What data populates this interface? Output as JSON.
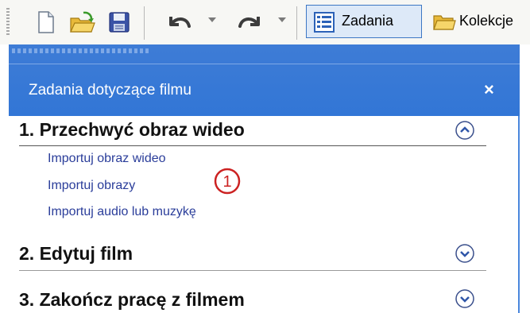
{
  "toolbar": {
    "tasks_button_label": "Zadania",
    "collections_button_label": "Kolekcje"
  },
  "panel": {
    "title": "Zadania dotyczące filmu",
    "close_glyph": "×",
    "sections": [
      {
        "title": "1. Przechwyć obraz wideo",
        "expanded": true,
        "links": [
          "Importuj obraz wideo",
          "Importuj obrazy",
          "Importuj audio lub muzykę"
        ]
      },
      {
        "title": "2. Edytuj film",
        "expanded": false
      },
      {
        "title": "3. Zakończ pracę z filmem",
        "expanded": false
      }
    ]
  },
  "annotation": {
    "number": "1",
    "color": "#cc2222"
  },
  "colors": {
    "header_blue": "#3276d6",
    "link_blue": "#2a3d9a",
    "chevron_blue": "#2f56a8"
  }
}
